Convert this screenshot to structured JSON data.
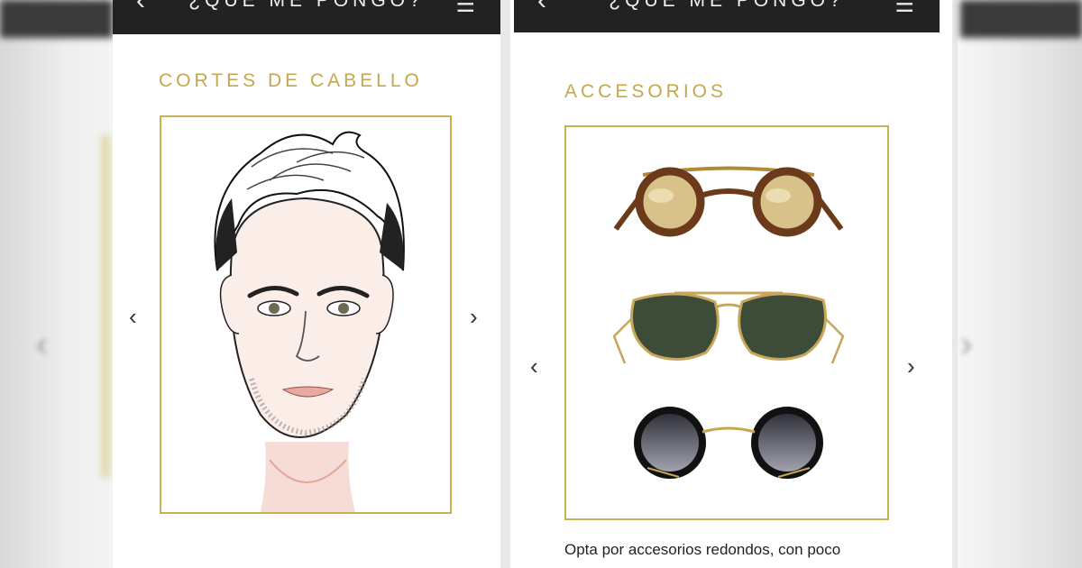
{
  "app_title": "¿QUÉ ME PONGO?",
  "icons": {
    "back": "chevron-left-icon",
    "menu": "hamburger-menu-icon",
    "prev": "chevron-left-icon",
    "next": "chevron-right-icon"
  },
  "colors": {
    "accent_gold": "#c2a84e",
    "topbar": "#222222"
  },
  "left_screen": {
    "section_title": "CORTES DE CABELLO",
    "image": "illustration-man-haircut"
  },
  "right_screen": {
    "section_title": "ACCESORIOS",
    "items": [
      "round-tortoise-sunglasses",
      "aviator-sunglasses",
      "round-black-sunglasses"
    ],
    "description": "Opta por accesorios redondos, con poco"
  }
}
